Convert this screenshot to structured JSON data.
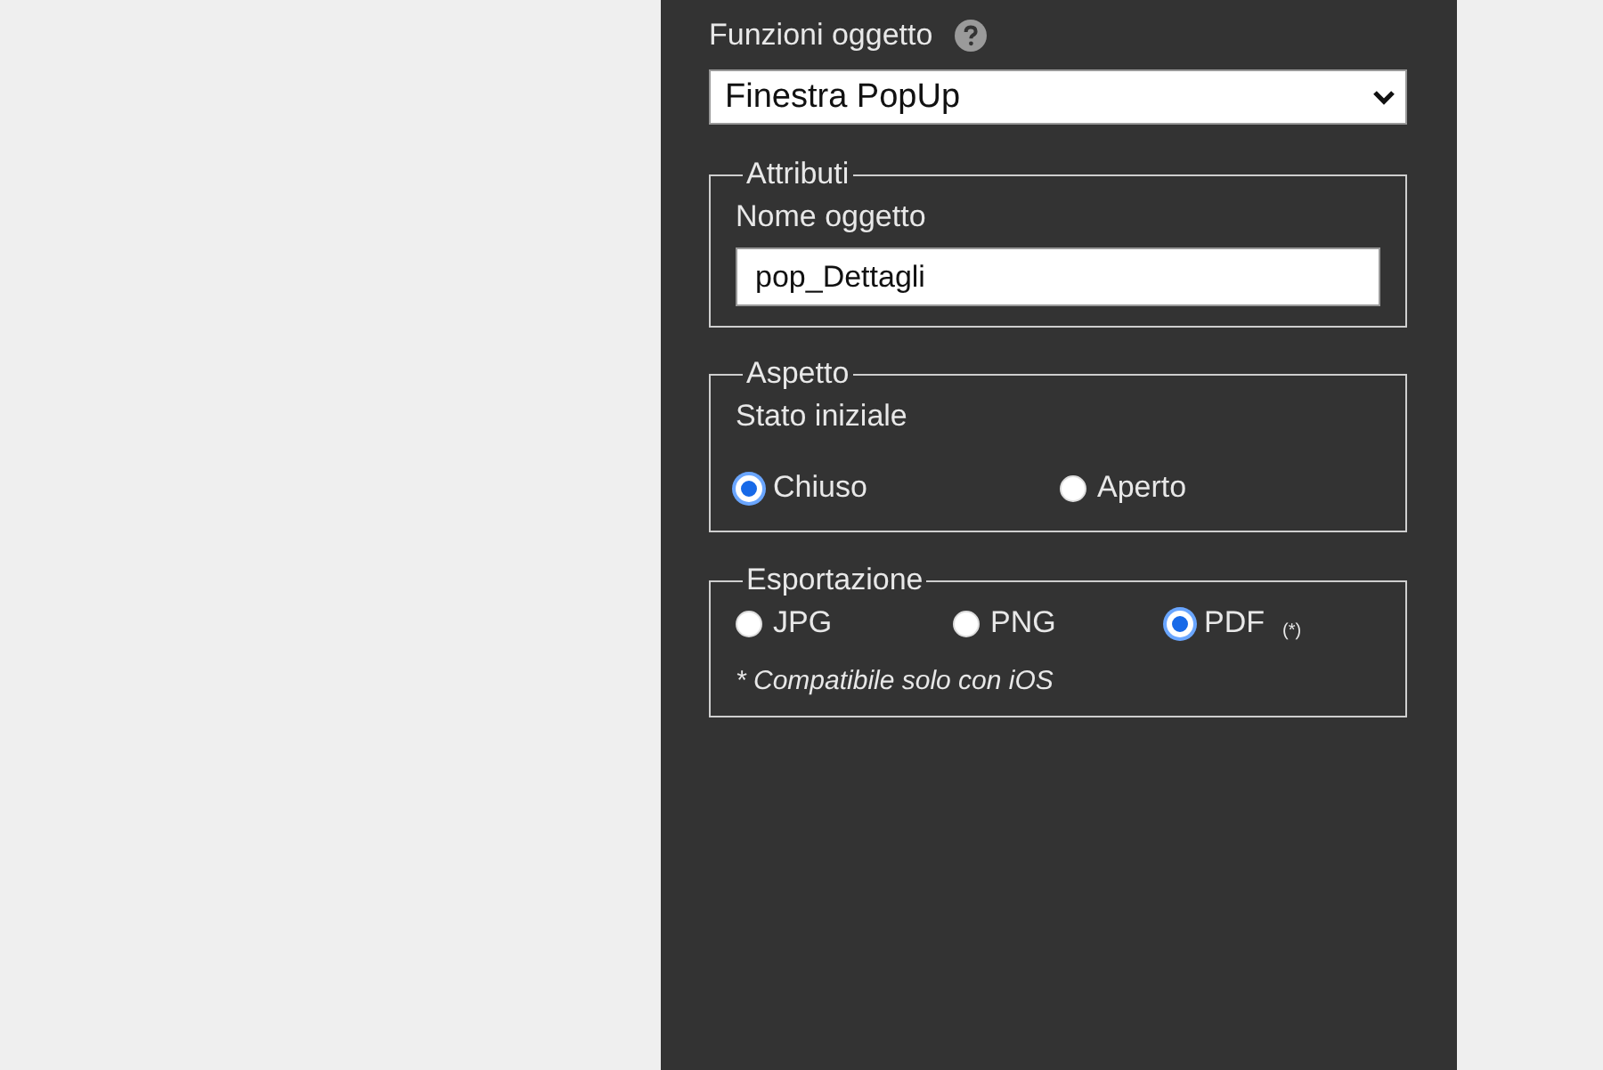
{
  "object_functions": {
    "label": "Funzioni oggetto",
    "value": "Finestra PopUp"
  },
  "attributes": {
    "legend": "Attributi",
    "name_label": "Nome oggetto",
    "name_value": "pop_Dettagli"
  },
  "appearance": {
    "legend": "Aspetto",
    "label": "Stato iniziale",
    "options": [
      {
        "label": "Chiuso",
        "selected": true
      },
      {
        "label": "Aperto",
        "selected": false
      }
    ]
  },
  "export": {
    "legend": "Esportazione",
    "options": [
      {
        "label": "JPG",
        "selected": false
      },
      {
        "label": "PNG",
        "selected": false
      },
      {
        "label": "PDF",
        "note": "(*)",
        "selected": true
      }
    ],
    "footnote": "* Compatibile solo con iOS"
  }
}
